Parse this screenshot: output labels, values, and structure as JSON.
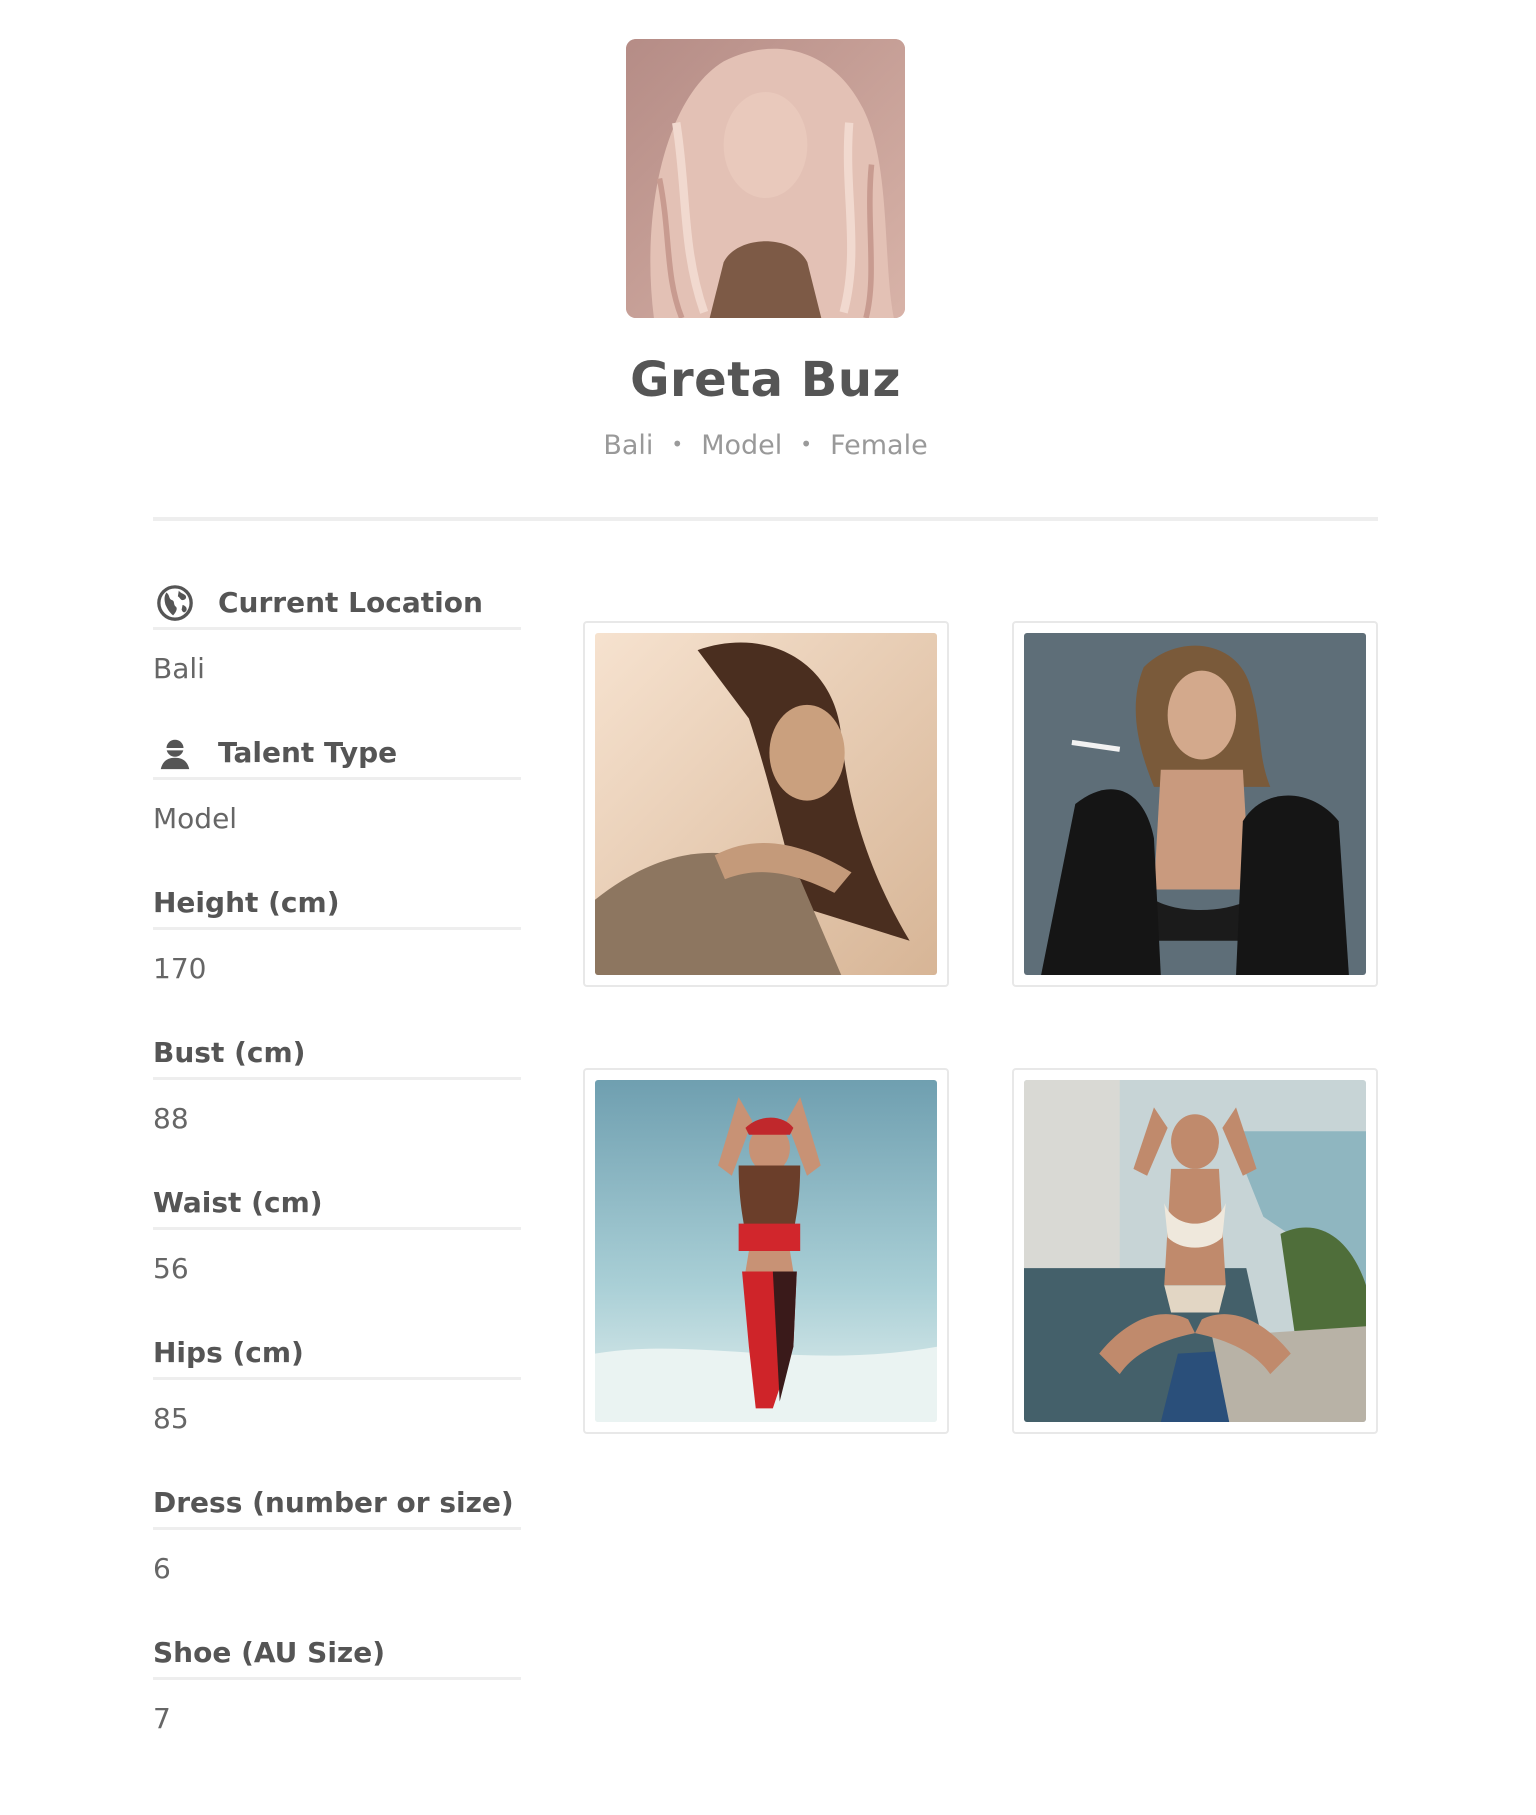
{
  "profile": {
    "name": "Greta Buz",
    "meta": {
      "location": "Bali",
      "talent_type": "Model",
      "gender": "Female",
      "separator": "•"
    },
    "avatar_icon": "profile-photo"
  },
  "attributes": [
    {
      "label": "Current Location",
      "value": "Bali",
      "icon": "globe-icon"
    },
    {
      "label": "Talent Type",
      "value": "Model",
      "icon": "person-icon"
    },
    {
      "label": "Height (cm)",
      "value": "170"
    },
    {
      "label": "Bust (cm)",
      "value": "88"
    },
    {
      "label": "Waist (cm)",
      "value": "56"
    },
    {
      "label": "Hips (cm)",
      "value": "85"
    },
    {
      "label": "Dress (number or size)",
      "value": "6"
    },
    {
      "label": "Shoe (AU Size)",
      "value": "7"
    }
  ],
  "gallery": {
    "photos": [
      {
        "subject": "portrait-sequin-dress"
      },
      {
        "subject": "portrait-black-blazer"
      },
      {
        "subject": "beach-red-outfit"
      },
      {
        "subject": "poolside-white-bikini"
      }
    ]
  },
  "colors": {
    "text_primary": "#555555",
    "text_secondary": "#999999",
    "divider": "#eeeeee",
    "background": "#ffffff"
  }
}
